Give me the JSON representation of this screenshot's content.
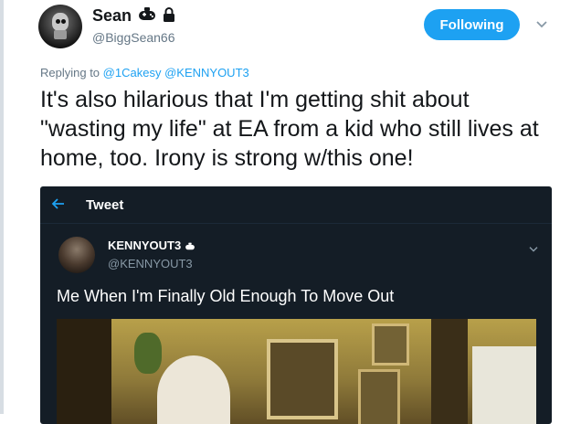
{
  "author": {
    "name": "Sean",
    "handle": "@BiggSean66",
    "badge_icons": [
      "gamepad-icon",
      "lock-icon"
    ]
  },
  "follow_button": {
    "label": "Following"
  },
  "reply_line": {
    "prefix": "Replying to",
    "mentions": [
      "@1Cakesy",
      "@KENNYOUT3"
    ]
  },
  "tweet": {
    "text": "It's also hilarious that I'm getting shit about \"wasting my life\" at EA from a kid who still lives at home, too. Irony is strong w/this one!"
  },
  "quoted_tweet": {
    "header_title": "Tweet",
    "name": "KENNYOUT3",
    "handle": "@KENNYOUT3",
    "text": "Me When I'm Finally Old Enough To Move Out"
  },
  "colors": {
    "accent": "#1da1f2",
    "embed_bg": "#141d26",
    "muted_text": "#657786"
  }
}
